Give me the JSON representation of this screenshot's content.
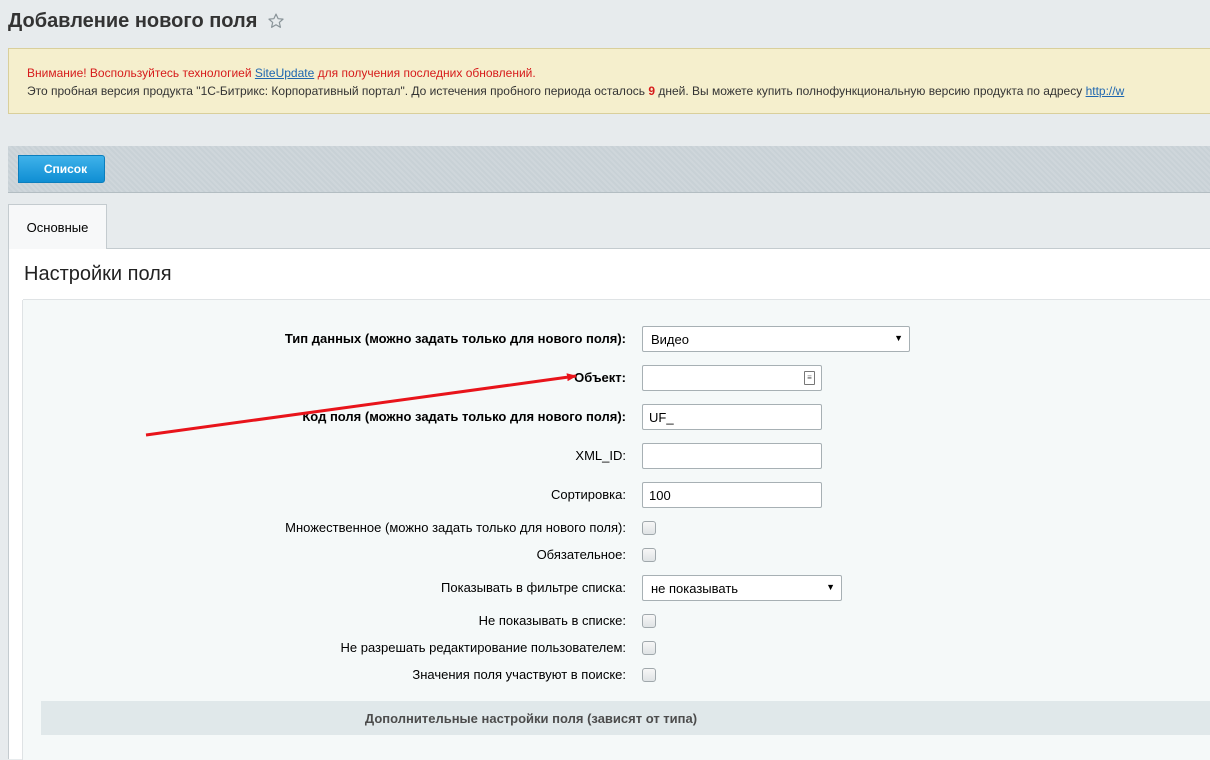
{
  "header": {
    "title": "Добавление нового поля",
    "star_icon": "star-icon"
  },
  "notice": {
    "line1_prefix": "Внимание! Воспользуйтесь технологией",
    "line1_link": "SiteUpdate",
    "line1_suffix": "для получения последних обновлений.",
    "line2_prefix": "Это пробная версия продукта \"1С-Битрикс: Корпоративный портал\". До истечения пробного периода осталось",
    "line2_days": "9",
    "line2_suffix": "дней. Вы можете купить полнофункциональную версию продукта по адресу",
    "line2_link": "http://w"
  },
  "toolbar": {
    "list_button": "Список"
  },
  "tabs": [
    {
      "label": "Основные"
    }
  ],
  "section": {
    "title": "Настройки поля"
  },
  "form": {
    "data_type": {
      "label": "Тип данных (можно задать только для нового поля):",
      "value": "Видео"
    },
    "object": {
      "label": "Объект:",
      "value": ""
    },
    "field_code": {
      "label": "Код поля (можно задать только для нового поля):",
      "value": "UF_"
    },
    "xml_id": {
      "label": "XML_ID:",
      "value": ""
    },
    "sort": {
      "label": "Сортировка:",
      "value": "100"
    },
    "multiple": {
      "label": "Множественное (можно задать только для нового поля):",
      "checked": false
    },
    "required": {
      "label": "Обязательное:",
      "checked": false
    },
    "filter": {
      "label": "Показывать в фильтре списка:",
      "value": "не показывать"
    },
    "hide_in_list": {
      "label": "Не показывать в списке:",
      "checked": false
    },
    "no_user_edit": {
      "label": "Не разрешать редактирование пользователем:",
      "checked": false
    },
    "searchable": {
      "label": "Значения поля участвуют в поиске:",
      "checked": false
    }
  },
  "extra_settings": {
    "label": "Дополнительные настройки поля (зависят от типа)"
  },
  "colors": {
    "accent": "#0f8ed3",
    "warning": "#d61b1b",
    "annotation_arrow": "#e8141b"
  }
}
